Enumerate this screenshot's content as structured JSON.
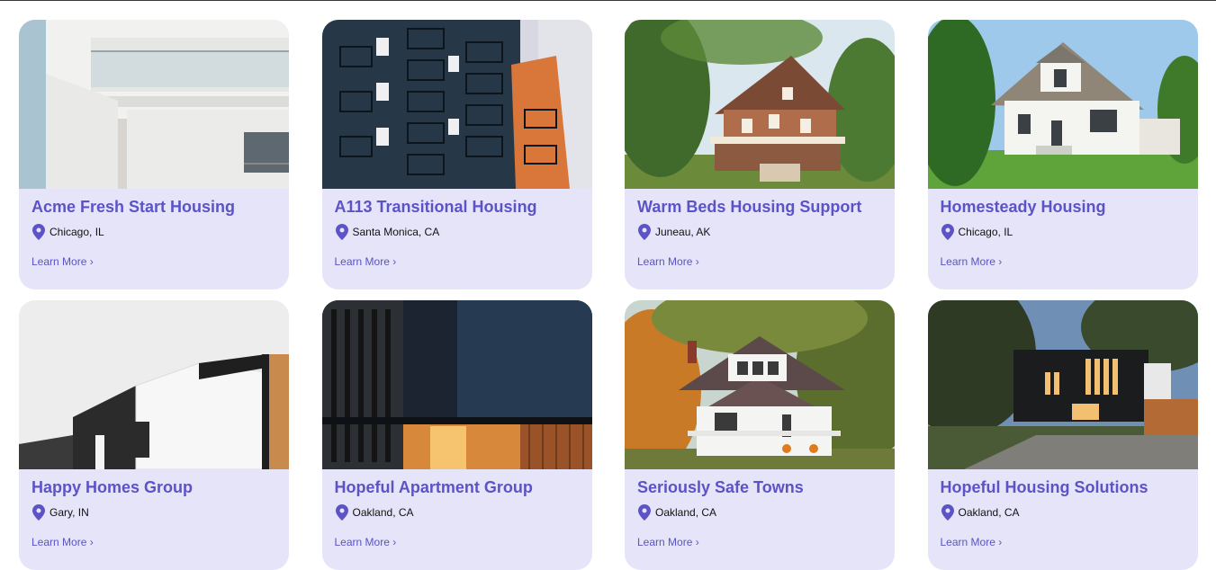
{
  "listings": [
    {
      "title": "Acme Fresh Start Housing",
      "location": "Chicago, IL",
      "link_label": "Learn More ›",
      "photo": "modern-white-apartment-balconies"
    },
    {
      "title": "A113 Transitional Housing",
      "location": "Santa Monica, CA",
      "link_label": "Learn More ›",
      "photo": "blue-apartment-tower-balconies"
    },
    {
      "title": "Warm Beds Housing Support",
      "location": "Juneau, AK",
      "link_label": "Learn More ›",
      "photo": "victorian-brick-house-trees"
    },
    {
      "title": "Homesteady Housing",
      "location": "Chicago, IL",
      "link_label": "Learn More ›",
      "photo": "white-cape-cod-house-lawn"
    },
    {
      "title": "Happy Homes Group",
      "location": "Gary, IN",
      "link_label": "Learn More ›",
      "photo": "white-modern-house-grey-sky"
    },
    {
      "title": "Hopeful Apartment Group",
      "location": "Oakland, CA",
      "link_label": "Learn More ›",
      "photo": "dark-modern-building-wood-slats"
    },
    {
      "title": "Seriously Safe Towns",
      "location": "Oakland, CA",
      "link_label": "Learn More ›",
      "photo": "white-bungalow-autumn-trees"
    },
    {
      "title": "Hopeful Housing Solutions",
      "location": "Oakland, CA",
      "link_label": "Learn More ›",
      "photo": "black-modern-house-dusk"
    }
  ],
  "colors": {
    "accent": "#5b53c6",
    "card_background": "#e5e4f8",
    "pin": "#5b53c6"
  },
  "icons": {
    "location": "map-pin-icon"
  }
}
